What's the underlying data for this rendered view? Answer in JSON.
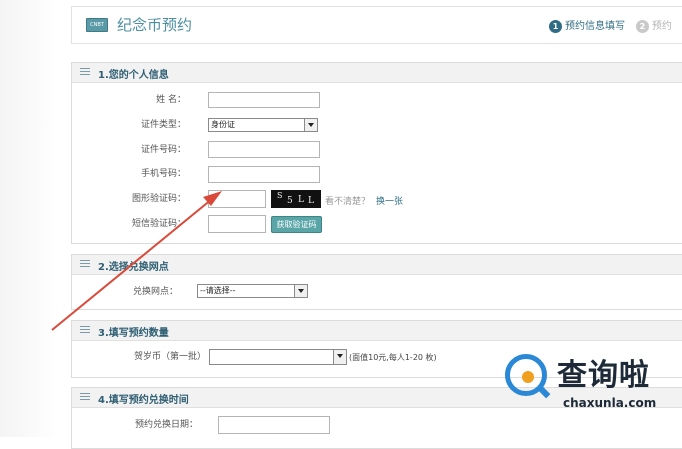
{
  "header": {
    "logo_text": "CNBT",
    "title": "纪念币预约",
    "steps": [
      {
        "num": "1",
        "label": "预约信息填写",
        "state": "active"
      },
      {
        "num": "2",
        "label": "预约",
        "state": "inactive"
      }
    ]
  },
  "section1": {
    "title": "1.您的个人信息",
    "name_label": "姓  名：",
    "id_type_label": "证件类型：",
    "id_type_value": "身份证",
    "id_number_label": "证件号码：",
    "phone_label": "手机号码：",
    "captcha_label": "图形验证码：",
    "captcha_chars": [
      "S",
      "5",
      "L",
      "L"
    ],
    "captcha_hint": "看不清楚？",
    "captcha_refresh": "换一张",
    "sms_label": "短信验证码：",
    "sms_button": "获取验证码"
  },
  "section2": {
    "title": "2.选择兑换网点",
    "outlet_label": "兑换网点：",
    "outlet_value": "--请选择--"
  },
  "section3": {
    "title": "3.填写预约数量",
    "coin_label": "贺岁币（第一批）",
    "coin_note": "(面值10元,每人1-20 枚)"
  },
  "section4": {
    "title": "4.填写预约兑换时间",
    "date_label": "预约兑换日期："
  },
  "watermark": {
    "brand": "查询啦",
    "url": "chaxunla.com"
  },
  "colors": {
    "accent": "#2f6d84",
    "title": "#4d8fa0",
    "annotation_arrow": "#d94a3a",
    "sms_button": "#5aa5a8"
  }
}
